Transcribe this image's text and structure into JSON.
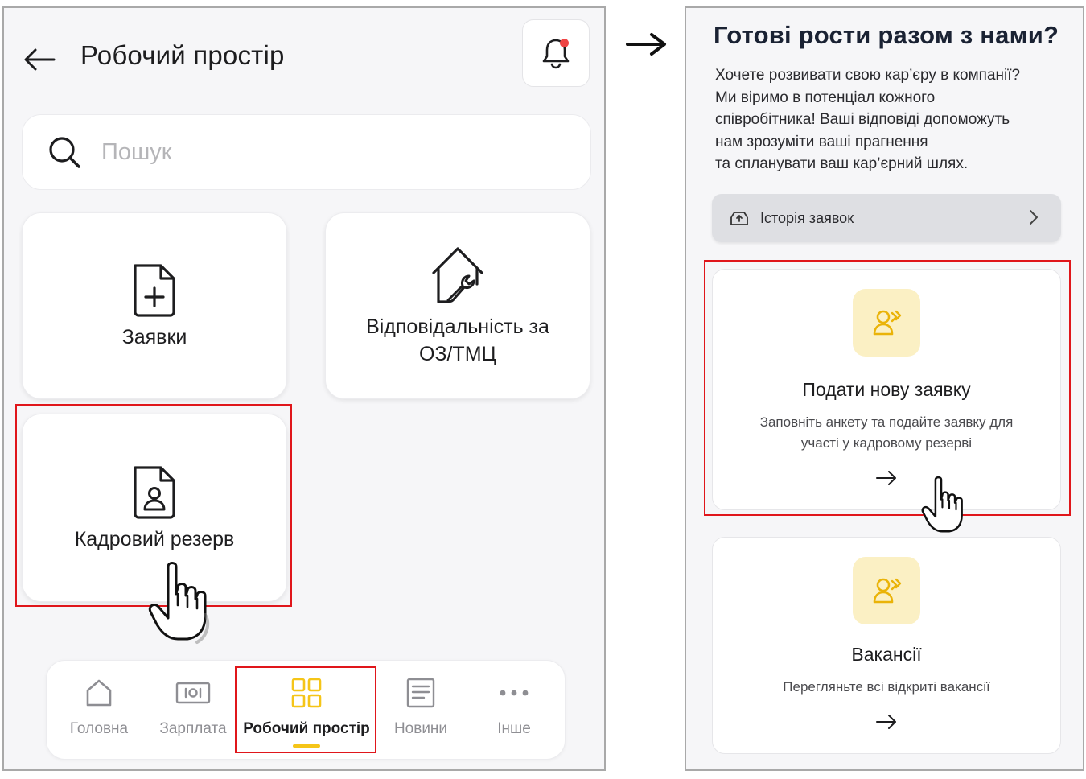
{
  "left": {
    "header": {
      "title": "Робочий простір"
    },
    "search": {
      "placeholder": "Пошук"
    },
    "tiles": [
      {
        "label": "Заявки",
        "icon": "document-plus-icon"
      },
      {
        "label_line1": "Відповідальність за",
        "label_line2": "ОЗ/ТМЦ",
        "icon": "house-wrench-icon"
      },
      {
        "label": "Кадровий резерв",
        "icon": "document-person-icon"
      }
    ],
    "bottom_nav": [
      {
        "label": "Головна",
        "icon": "home-icon"
      },
      {
        "label": "Зарплата",
        "icon": "salary-icon"
      },
      {
        "label": "Робочий простір",
        "icon": "grid-icon",
        "active": true
      },
      {
        "label": "Новини",
        "icon": "news-icon"
      },
      {
        "label": "Інше",
        "icon": "more-dots-icon"
      }
    ]
  },
  "right": {
    "title": "Готові рости разом з нами?",
    "text_lines": [
      "Хочете розвивати свою кар’єру в компанії?",
      "Ми віримо в потенціал кожного",
      "співробітника! Ваші відповіді допоможуть",
      "нам зрозуміти ваші прагнення",
      "та спланувати ваш кар’єрний шлях."
    ],
    "history": {
      "label": "Історія заявок"
    },
    "cards": [
      {
        "title": "Подати нову заявку",
        "desc_line1": "Заповніть анкету та подайте заявку для",
        "desc_line2": "участі у кадровому резерві"
      },
      {
        "title": "Вакансії",
        "desc_line1": "Перегляньте всі відкриті вакансії"
      }
    ]
  },
  "colors": {
    "accent_yellow": "#f5c518",
    "icon_yellow_bg": "#fbf0c4",
    "highlight_red": "#e0161b",
    "notification_red": "#ef4444"
  }
}
